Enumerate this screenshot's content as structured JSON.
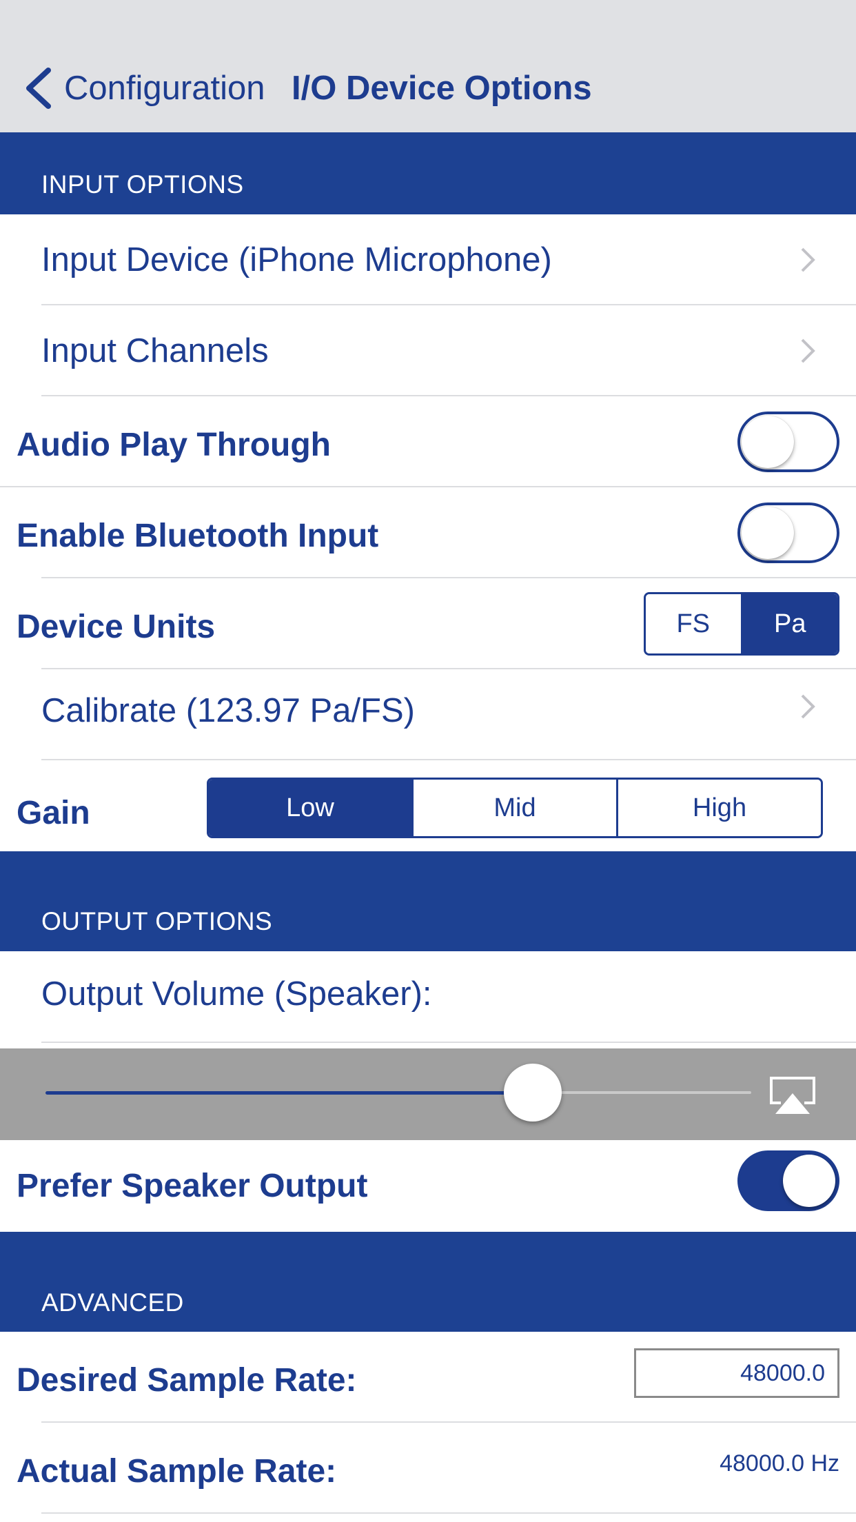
{
  "navbar": {
    "back_label": "Configuration",
    "title": "I/O Device Options"
  },
  "input_options": {
    "header": "INPUT OPTIONS",
    "input_device_label": "Input Device (iPhone Microphone)",
    "input_channels_label": "Input Channels",
    "audio_play_through": {
      "label": "Audio Play Through",
      "on": false
    },
    "bluetooth_input": {
      "label": "Enable Bluetooth Input",
      "on": false
    },
    "device_units": {
      "label": "Device Units",
      "options": [
        "FS",
        "Pa"
      ],
      "selected": "Pa"
    },
    "calibrate_label": "Calibrate (123.97 Pa/FS)",
    "gain": {
      "label": "Gain",
      "options": [
        "Low",
        "Mid",
        "High"
      ],
      "selected": "Low"
    }
  },
  "output_options": {
    "header": "OUTPUT OPTIONS",
    "output_volume_label": "Output Volume (Speaker):",
    "volume_level": 0.69,
    "prefer_speaker": {
      "label": "Prefer Speaker Output",
      "on": true
    }
  },
  "advanced": {
    "header": "ADVANCED",
    "desired_rate_label": "Desired Sample Rate:",
    "desired_rate_value": "48000.0",
    "actual_rate_label": "Actual Sample Rate:",
    "actual_rate_value": "48000.0 Hz"
  },
  "icons": {
    "back": "chevron-left-icon",
    "disclosure": "chevron-right-icon",
    "airplay": "airplay-icon"
  },
  "colors": {
    "accent": "#1d3c8f",
    "section_background": "#1d4192",
    "navbar_background": "#e0e1e4",
    "volume_bar_background": "#a0a0a0"
  }
}
